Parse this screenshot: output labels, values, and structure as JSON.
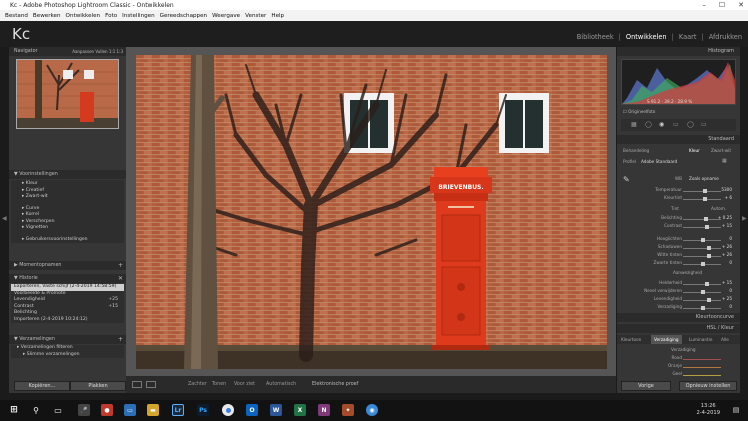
{
  "window": {
    "title": "Kc - Adobe Photoshop Lightroom Classic - Ontwikkelen",
    "ctrls": [
      "–",
      "☐",
      "✕"
    ]
  },
  "menu": [
    "Bestand",
    "Bewerken",
    "Ontwikkelen",
    "Foto",
    "Instellingen",
    "Gereedschappen",
    "Weergave",
    "Venster",
    "Help"
  ],
  "app": {
    "logo": "Kc",
    "modules": [
      "Bibliotheek",
      "Ontwikkelen",
      "Kaart",
      "Afdrukken"
    ],
    "active_module": "Ontwikkelen"
  },
  "left": {
    "navigator": {
      "title": "Navigator",
      "options": "Aanpassen  Vullen  1:1  1:3"
    },
    "presets": {
      "title": "Voorinstellingen",
      "items": [
        "Kleur",
        "Creatief",
        "Zwart-wit",
        "Curve",
        "Korrel",
        "Verscherpen",
        "Vignetten",
        "Gebruikersvoorinstellingen"
      ]
    },
    "snapshots": {
      "title": "Momentopnamen"
    },
    "history": {
      "title": "Historie",
      "items": [
        {
          "label": "Exporteren, Vaste schijf (2-4-2019 14:58:59)",
          "value": "",
          "selected": true
        },
        {
          "label": "Voorbeelde & Promote",
          "value": ""
        },
        {
          "label": "Levendigheid",
          "value": "+25"
        },
        {
          "label": "Contrast",
          "value": "+15"
        },
        {
          "label": "Belichting",
          "value": ""
        },
        {
          "label": "Importeren (2-4-2019 10:24:12)",
          "value": ""
        }
      ]
    },
    "collections": {
      "title": "Verzamelingen",
      "items": [
        "Verzamelingen filteren",
        "Slimme verzamelingen"
      ]
    },
    "buttons": {
      "copy": "Kopiëren...",
      "paste": "Plakken"
    }
  },
  "center": {
    "sign": "BRIEVENBUS.",
    "toolbar": {
      "zoom": "Zachter",
      "compare": "Tonen",
      "view": "Voor ziet",
      "auto": "Automatisch",
      "proof": "Elektronische proef"
    }
  },
  "right": {
    "histogram": {
      "title": "Histogram",
      "readout": "S  91.2  ·  39.2  ·  28.9 %",
      "orig": "Origineelfoto"
    },
    "basic": {
      "title": "Standaard",
      "treatment_label": "Behandeling",
      "color": "Kleur",
      "bw": "Zwart-wit",
      "profile_label": "Profiel",
      "profile": "Adobe Standaard",
      "wb_label": "WB",
      "wb": "Zoals opname",
      "sliders": [
        {
          "label": "Temperatuur",
          "value": "5300"
        },
        {
          "label": "Kleurtint",
          "value": "+ 6"
        },
        {
          "label": "Belichting",
          "value": "+ 0.25"
        },
        {
          "label": "Contrast",
          "value": "+ 15"
        },
        {
          "label": "Hooglichten",
          "value": "0"
        },
        {
          "label": "Schaduwen",
          "value": "+ 26"
        },
        {
          "label": "Witte tinten",
          "value": "+ 26"
        },
        {
          "label": "Zwarte tinten",
          "value": "0"
        },
        {
          "label": "Helderheid",
          "value": "+ 15"
        },
        {
          "label": "Nevel verwijderen",
          "value": "0"
        },
        {
          "label": "Levendigheid",
          "value": "+ 25"
        },
        {
          "label": "Verzadiging",
          "value": "0"
        }
      ],
      "tone_label": "Tint",
      "auto_label": "Autom.",
      "presence_label": "Aanwezigheid"
    },
    "curve": {
      "title": "Kleurtooncurve"
    },
    "hsl": {
      "title": "HSL / Kleur",
      "tabs": [
        "Kleurtoon",
        "Verzadiging",
        "Luminantie",
        "Alle"
      ],
      "sub": "Verzadiging",
      "items": [
        "Rood",
        "Oranje",
        "Geel"
      ]
    },
    "buttons": {
      "prev": "Vorige",
      "reset": "Opnieuw instellen"
    }
  },
  "taskbar": {
    "time": "13:26",
    "date": "2-4-2019",
    "apps": [
      "Lr",
      "Ps",
      "W",
      "X",
      "N"
    ]
  }
}
